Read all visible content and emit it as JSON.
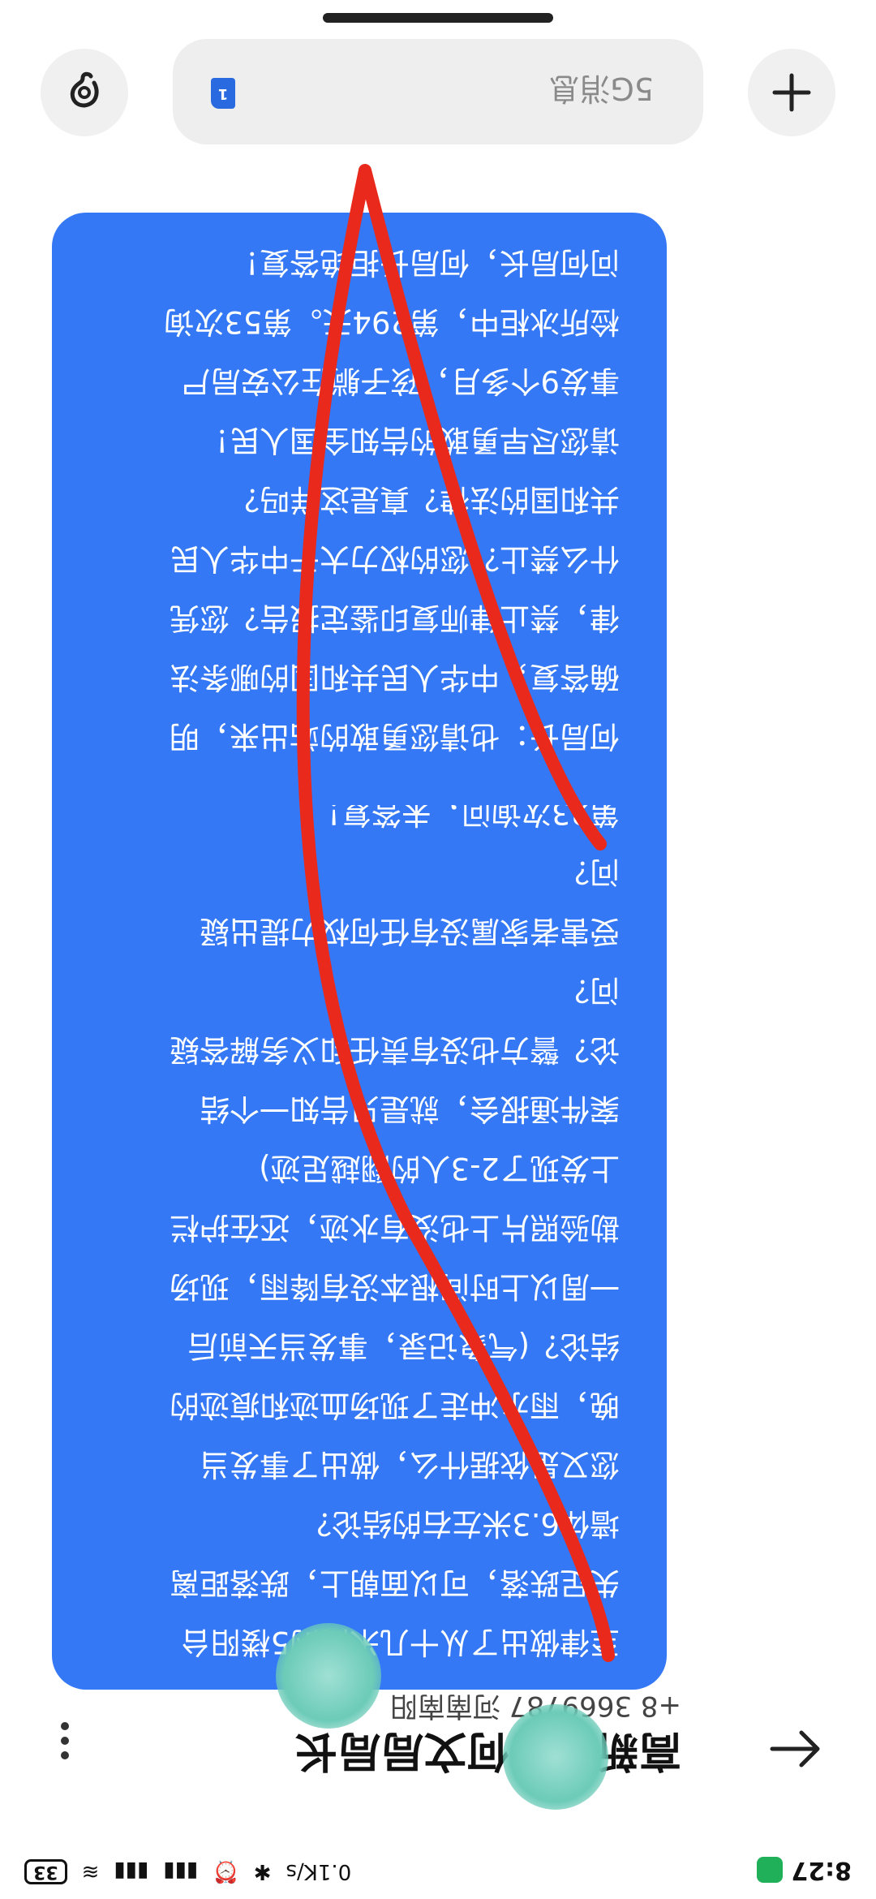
{
  "status_bar": {
    "time": "8:27",
    "network_speed": "0.1K/s",
    "battery": "33"
  },
  "header": {
    "contact_name": "高新分局何文局局长",
    "contact_number": "+8 3669787 河南南阳"
  },
  "messages": [
    {
      "lines": [
        "至律做出了从十几米高的5楼阳台",
        "失足跌落，可以面朝上，跌落距离",
        "墙体6.3米左右的结论？",
        "您又是依据什么，做出了事发当",
        "晚，雨水冲走了现场血迹和痕迹的",
        "结论？(气象记录，事发当天前后",
        "一周以上时间根本没有降雨，现场",
        "勘验照片上也没有水迹，还在护栏",
        "上发现了2-3人的翻越足迹)",
        "案件通报会，就是只告知一个结",
        "论？警方也没有责任和义务解答疑",
        "问？",
        "受害者家属没有任何权力提出疑",
        "问？",
        "第23次询问，未答复！"
      ]
    },
    {
      "lines": [
        "何局长：也请您勇敢的站出来，明",
        "确答复，中华人民共和国的哪条法",
        "律，禁止律师复印鉴定报告？您凭",
        "什么禁止？您的权力大于中华人民",
        "共和国的法律？真是这样吗？",
        "请您尽早勇敢的告知全国人民！",
        "事发9个多月，孩子躺在公安局尸",
        "检所冰柜中，第294天。第53次询",
        "问何局长，何局长拒绝答复！"
      ]
    }
  ],
  "input_bar": {
    "placeholder": "5G消息",
    "sim_label": "1"
  },
  "colors": {
    "bubble": "#3478f6",
    "annotation_stroke": "#e8291c"
  }
}
